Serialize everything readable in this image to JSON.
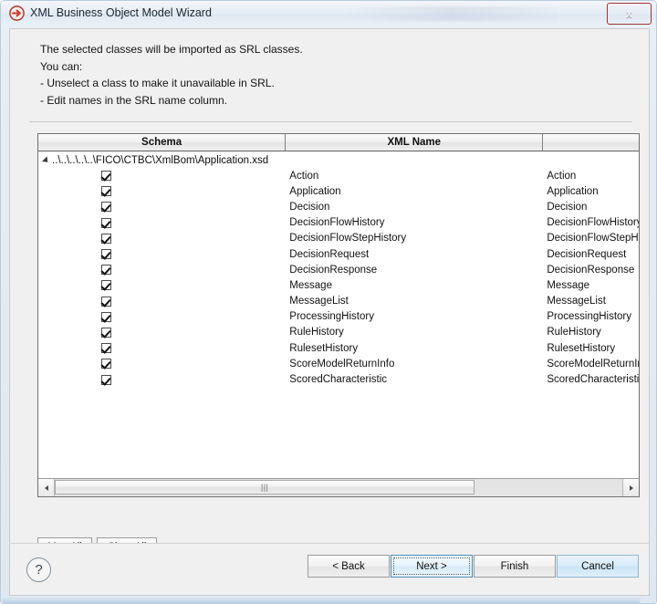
{
  "window": {
    "title": "XML Business Object Model Wizard",
    "icon": "right-arrow-circle-icon",
    "close_label": "x"
  },
  "instructions": {
    "line1": "The selected classes will be imported as SRL classes.",
    "line2": "You can:",
    "line3": "- Unselect a class to make it unavailable in SRL.",
    "line4": "- Edit names in the SRL name column."
  },
  "table": {
    "columns": [
      {
        "label": "Schema"
      },
      {
        "label": "XML Name"
      },
      {
        "label": ""
      }
    ],
    "root": {
      "path": "..\\..\\..\\..\\..\\FICO\\CTBC\\XmlBom\\Application.xsd",
      "expanded": true
    },
    "rows": [
      {
        "checked": true,
        "xml_name": "Action",
        "srl_name": "Action"
      },
      {
        "checked": true,
        "xml_name": "Application",
        "srl_name": "Application"
      },
      {
        "checked": true,
        "xml_name": "Decision",
        "srl_name": "Decision"
      },
      {
        "checked": true,
        "xml_name": "DecisionFlowHistory",
        "srl_name": "DecisionFlowHistory"
      },
      {
        "checked": true,
        "xml_name": "DecisionFlowStepHistory",
        "srl_name": "DecisionFlowStepHistory"
      },
      {
        "checked": true,
        "xml_name": "DecisionRequest",
        "srl_name": "DecisionRequest"
      },
      {
        "checked": true,
        "xml_name": "DecisionResponse",
        "srl_name": "DecisionResponse"
      },
      {
        "checked": true,
        "xml_name": "Message",
        "srl_name": "Message"
      },
      {
        "checked": true,
        "xml_name": "MessageList",
        "srl_name": "MessageList"
      },
      {
        "checked": true,
        "xml_name": "ProcessingHistory",
        "srl_name": "ProcessingHistory"
      },
      {
        "checked": true,
        "xml_name": "RuleHistory",
        "srl_name": "RuleHistory"
      },
      {
        "checked": true,
        "xml_name": "RulesetHistory",
        "srl_name": "RulesetHistory"
      },
      {
        "checked": true,
        "xml_name": "ScoreModelReturnInfo",
        "srl_name": "ScoreModelReturnInfo"
      },
      {
        "checked": true,
        "xml_name": "ScoredCharacteristic",
        "srl_name": "ScoredCharacteristic"
      }
    ],
    "scrollbar": {
      "grip": "|||",
      "left_arrow": "left-arrow-icon",
      "right_arrow": "right-arrow-icon"
    }
  },
  "actions": {
    "map_all": "Map All",
    "clear_all": "Clear All"
  },
  "footer": {
    "help": "?",
    "back": "< Back",
    "next": "Next >",
    "finish": "Finish",
    "cancel": "Cancel"
  },
  "colors": {
    "accent": "#4c8db5",
    "close_red": "#c4332b",
    "panel": "#f0f0f0"
  }
}
